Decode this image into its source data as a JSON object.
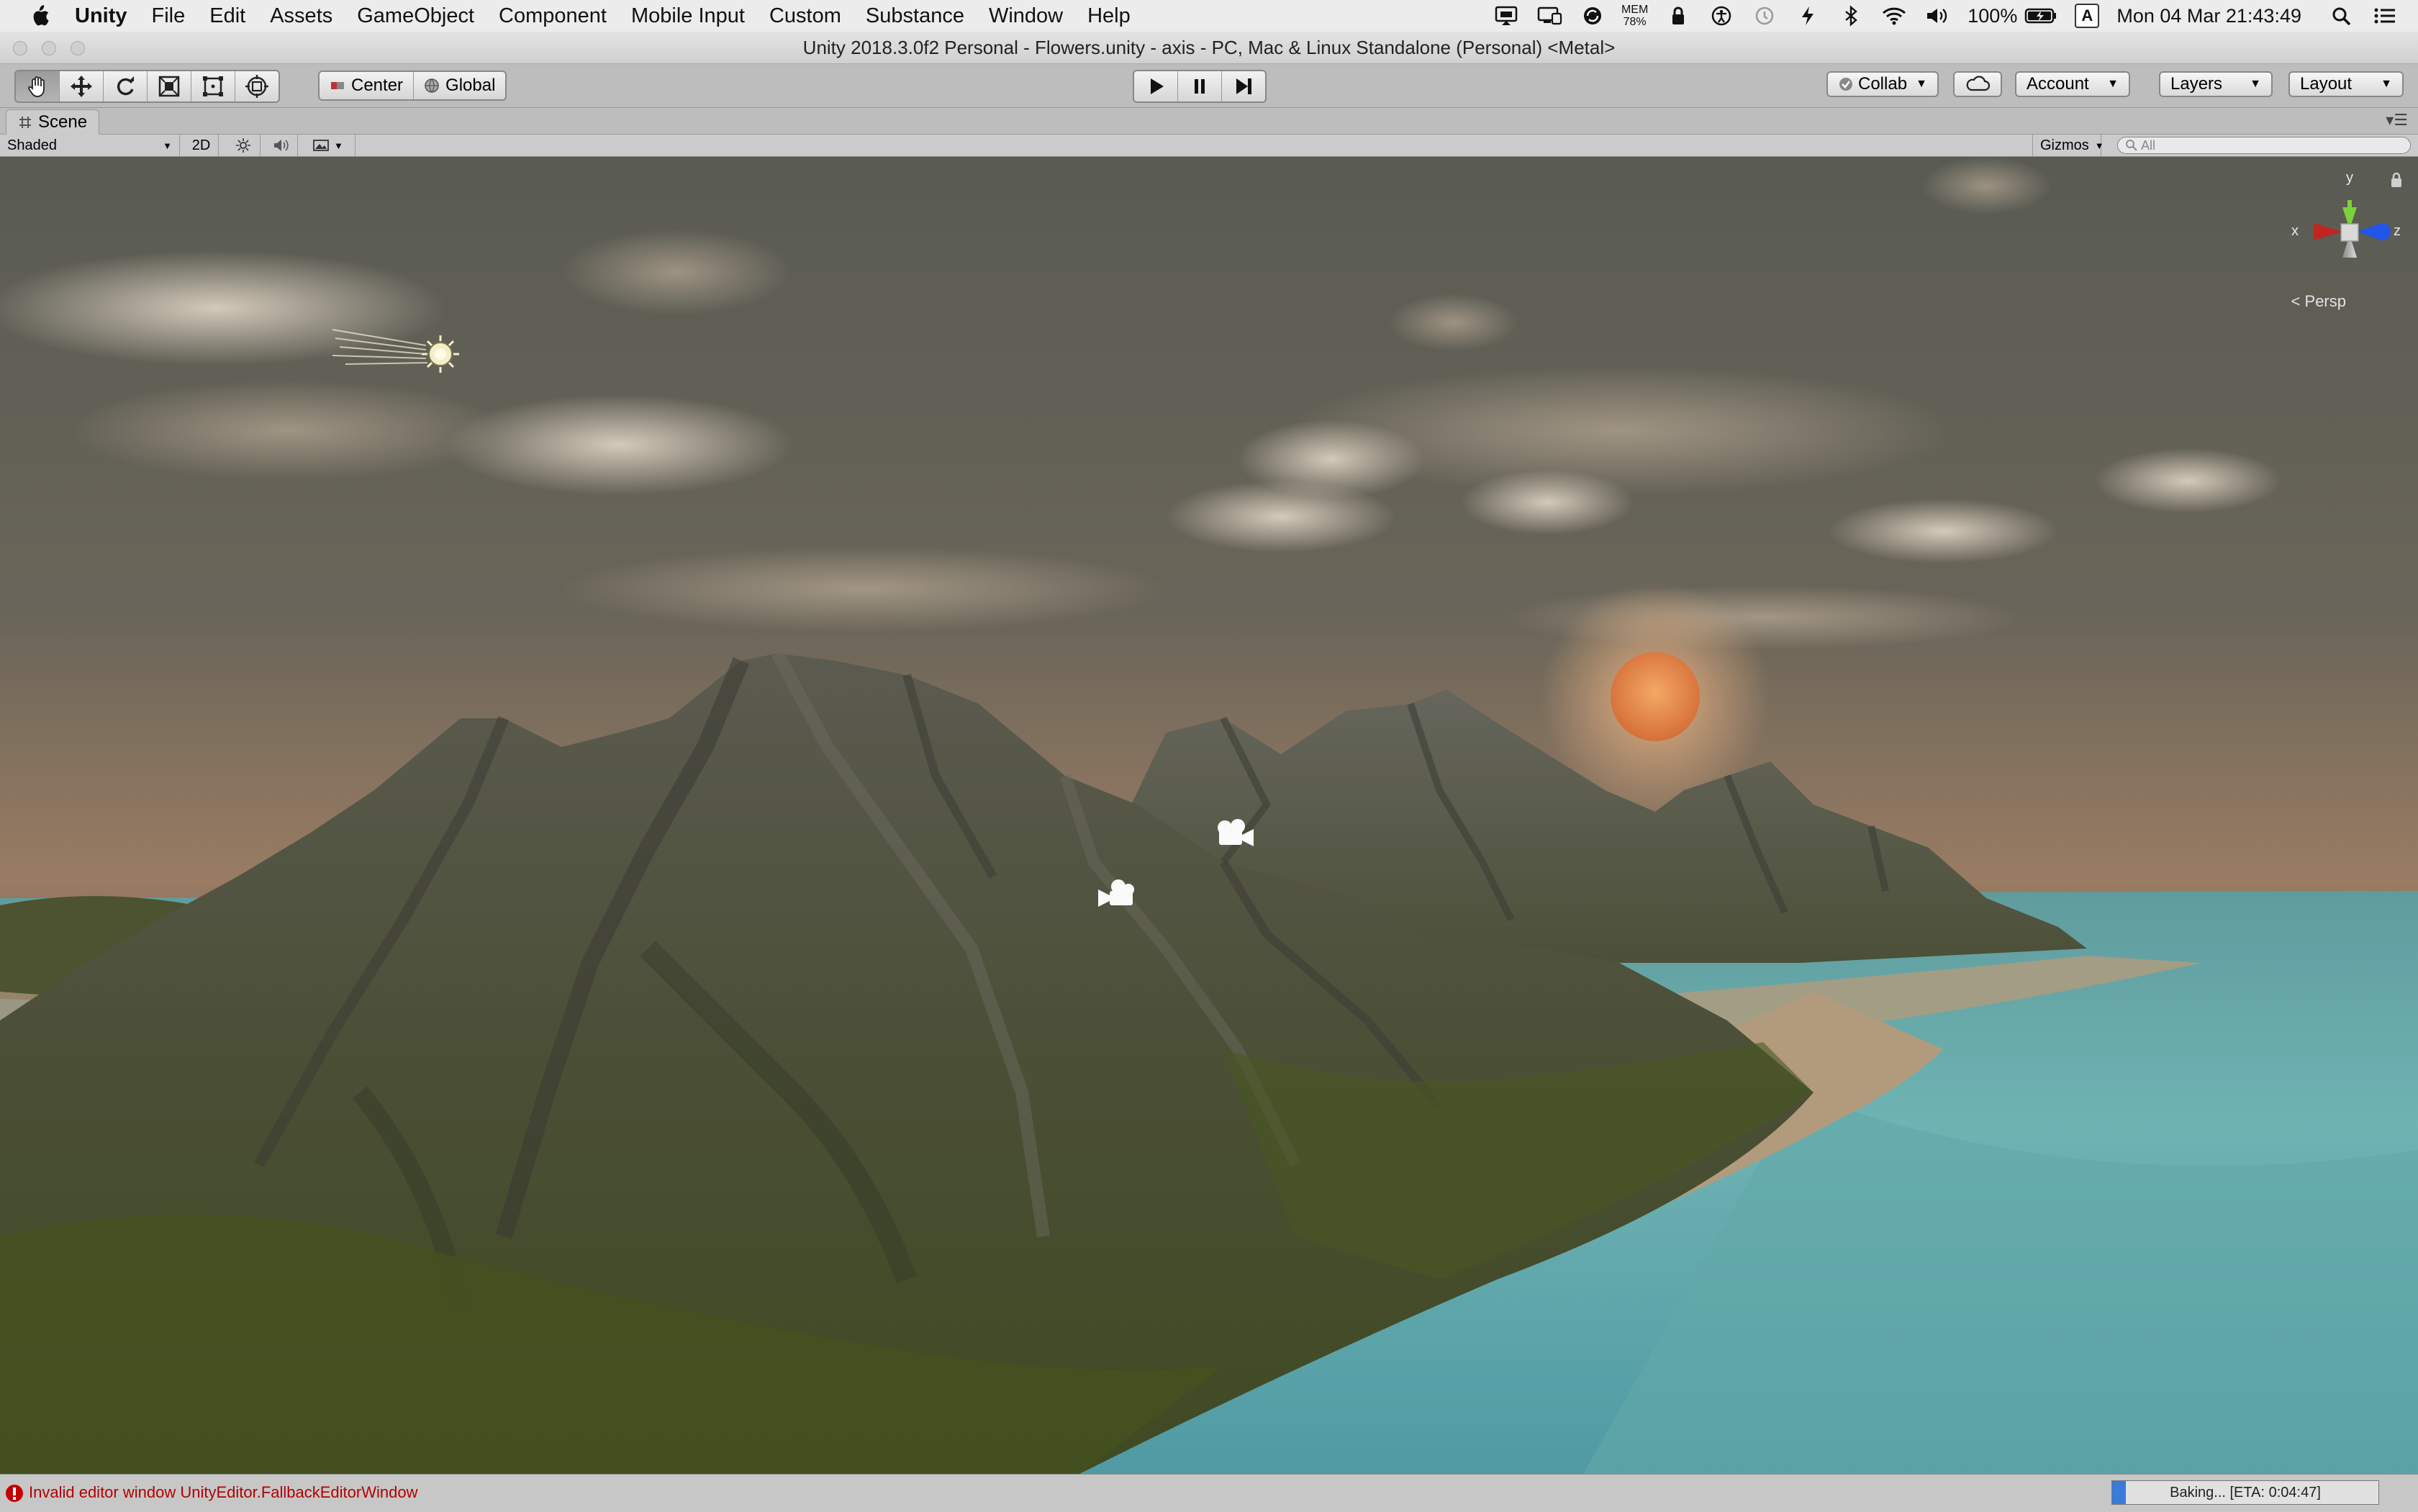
{
  "menubar": {
    "app_name": "Unity",
    "items": [
      "File",
      "Edit",
      "Assets",
      "GameObject",
      "Component",
      "Mobile Input",
      "Custom",
      "Substance",
      "Window",
      "Help"
    ],
    "status": {
      "mem_label": "MEM",
      "mem_value": "78%",
      "battery": "100%",
      "input_source": "A",
      "clock": "Mon 04 Mar  21:43:49"
    }
  },
  "window": {
    "title": "Unity 2018.3.0f2 Personal - Flowers.unity - axis - PC, Mac & Linux Standalone (Personal) <Metal>"
  },
  "toolbar": {
    "tools": [
      "hand-tool",
      "move-tool",
      "rotate-tool",
      "scale-tool",
      "rect-tool",
      "transform-tool"
    ],
    "pivot_mode": "Center",
    "pivot_rotation": "Global",
    "play_controls": [
      "play",
      "pause",
      "step"
    ],
    "collab_label": "Collab",
    "account_label": "Account",
    "layers_label": "Layers",
    "layout_label": "Layout"
  },
  "scene": {
    "tab_label": "Scene",
    "draw_mode": "Shaded",
    "mode_2d": "2D",
    "gizmos_label": "Gizmos",
    "search_placeholder": "All",
    "projection": "Persp",
    "axis_labels": {
      "x": "x",
      "y": "y",
      "z": "z"
    }
  },
  "statusbar": {
    "error_message": "Invalid editor window UnityEditor.FallbackEditorWindow",
    "bake_label": "Baking... [ETA: 0:04:47]",
    "bake_progress": 0.05
  },
  "colors": {
    "sky_top": "#5a5c55",
    "sky_glow": "#b88a6a",
    "sun": "#e8874a",
    "water": "#5fa6a6",
    "grass": "#4f5a2a",
    "rock": "#55564c",
    "sand": "#b59a7a",
    "gizmo_x": "#c0261f",
    "gizmo_y": "#7cd13a",
    "gizmo_z": "#2255e8",
    "error_red": "#c40000",
    "progress_blue": "#3b7bd8"
  }
}
